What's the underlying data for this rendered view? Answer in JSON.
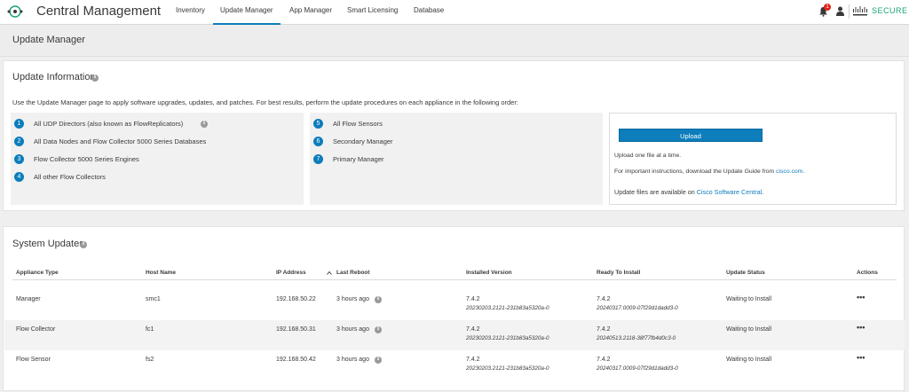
{
  "nav": {
    "app_title": "Central Management",
    "tabs": [
      "Inventory",
      "Update Manager",
      "App Manager",
      "Smart Licensing",
      "Database"
    ],
    "active_tab": "Update Manager",
    "notification_count": "1",
    "brand_word": "SECURE"
  },
  "page": {
    "title": "Update Manager"
  },
  "update_info": {
    "title": "Update Information",
    "intro": "Use the Update Manager page to apply software upgrades, updates, and patches. For best results, perform the update procedures on each appliance in the following order:",
    "steps_left": [
      {
        "num": "1",
        "label": "All UDP Directors (also known as FlowReplicators)"
      },
      {
        "num": "2",
        "label": "All Data Nodes and Flow Collector 5000 Series Databases"
      },
      {
        "num": "3",
        "label": "Flow Collector 5000 Series Engines"
      },
      {
        "num": "4",
        "label": "All other Flow Collectors"
      }
    ],
    "steps_right": [
      {
        "num": "5",
        "label": "All Flow Sensors"
      },
      {
        "num": "6",
        "label": "Secondary Manager"
      },
      {
        "num": "7",
        "label": "Primary Manager"
      }
    ],
    "upload": {
      "button": "Upload",
      "line1": "Upload one file at a time.",
      "line2_prefix": "For important instructions, download the Update Guide from ",
      "line2_link": "cisco.com",
      "line2_suffix": ".",
      "line3_prefix": "Update files are available on ",
      "line3_link": "Cisco Software Central",
      "line3_suffix": "."
    }
  },
  "system_updates": {
    "title": "System Updates",
    "columns": [
      "Appliance Type",
      "Host Name",
      "IP Address",
      "Last Reboot",
      "Installed Version",
      "Ready To Install",
      "Update Status",
      "Actions"
    ],
    "rows": [
      {
        "type": "Manager",
        "host": "smc1",
        "ip": "192.168.50.22",
        "reboot": "3 hours ago",
        "installed": "7.4.2",
        "installed_build": "20230203.2121-231b83a5320a-0",
        "ready": "7.4.2",
        "ready_build": "20240317.0009-07f29d1dadd3-0",
        "status": "Waiting to Install",
        "actions": "•••"
      },
      {
        "type": "Flow Collector",
        "host": "fc1",
        "ip": "192.168.50.31",
        "reboot": "3 hours ago",
        "installed": "7.4.2",
        "installed_build": "20230203.2121-231b83a5320a-0",
        "ready": "7.4.2",
        "ready_build": "20240513.2118-38f77fb4d0c3-0",
        "status": "Waiting to Install",
        "actions": "•••"
      },
      {
        "type": "Flow Sensor",
        "host": "fs2",
        "ip": "192.168.50.42",
        "reboot": "3 hours ago",
        "installed": "7.4.2",
        "installed_build": "20230203.2121-231b83a5320a-0",
        "ready": "7.4.2",
        "ready_build": "20240317.0009-07f29d1dadd3-0",
        "status": "Waiting to Install",
        "actions": "•••"
      }
    ]
  },
  "colors": {
    "accent": "#0d7dbb",
    "brand_green": "#1aa37a",
    "alert": "#e2231a"
  }
}
